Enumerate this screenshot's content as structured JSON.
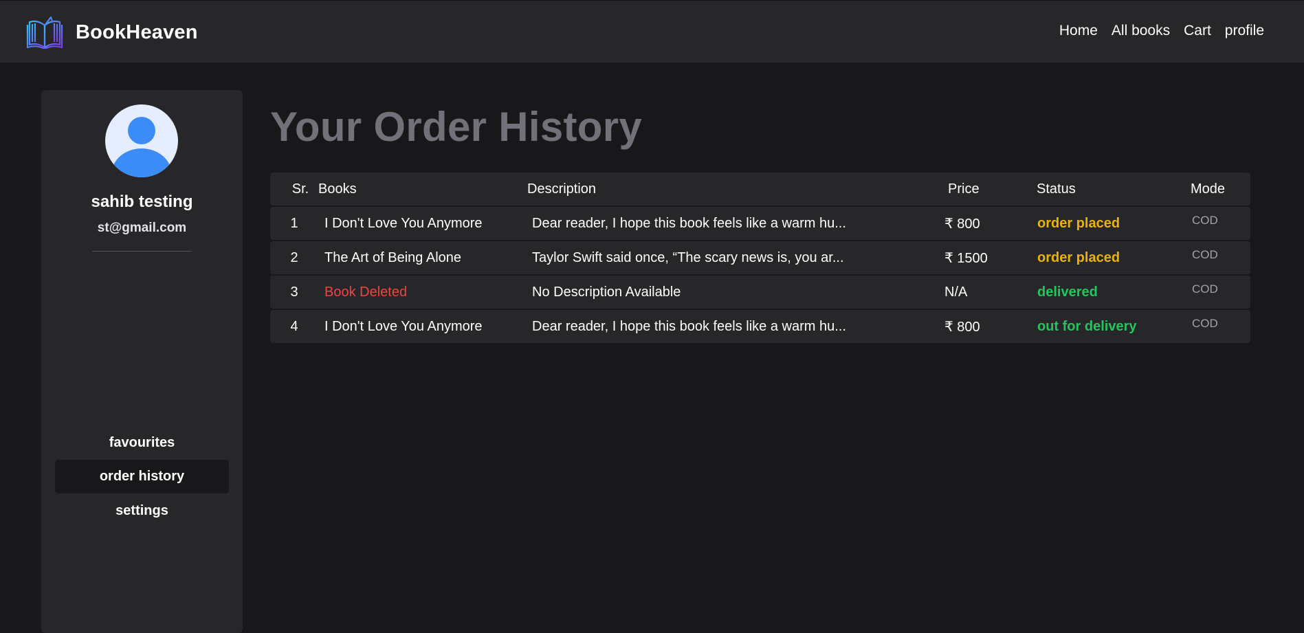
{
  "header": {
    "brand": "BookHeaven",
    "logo_icon": "open-book-icon",
    "nav": [
      "Home",
      "All books",
      "Cart",
      "profile"
    ]
  },
  "sidebar": {
    "avatar_icon": "user-avatar-icon",
    "name": "sahib testing",
    "email": "st@gmail.com",
    "menu": [
      "favourites",
      "order history",
      "settings"
    ],
    "active": "order history"
  },
  "main": {
    "title": "Your Order History",
    "columns": [
      "Sr.",
      "Books",
      "Description",
      "Price",
      "Status",
      "Mode"
    ],
    "orders": [
      {
        "sr": "1",
        "book": "I Don't Love You Anymore",
        "description": "Dear reader, I hope this book feels like a warm hu...",
        "price": "₹ 800",
        "status": "order placed",
        "mode": "COD"
      },
      {
        "sr": "2",
        "book": "The Art of Being Alone",
        "description": "Taylor Swift said once, “The scary news is, you ar...",
        "price": "₹ 1500",
        "status": "order placed",
        "mode": "COD"
      },
      {
        "sr": "3",
        "book": "Book Deleted",
        "description": "No Description Available",
        "price": "N/A",
        "status": "delivered",
        "mode": "COD"
      },
      {
        "sr": "4",
        "book": "I Don't Love You Anymore",
        "description": "Dear reader, I hope this book feels like a warm hu...",
        "price": "₹ 800",
        "status": "out for delivery",
        "mode": "COD"
      }
    ]
  },
  "colors": {
    "background": "#18181b",
    "panel": "#27272a",
    "title": "#71717a",
    "status_placed": "#eab308",
    "status_delivered": "#22c55e",
    "deleted_book": "#ef4444",
    "logo_gradient": [
      "#6366f1",
      "#38bdf8"
    ],
    "avatar_blue": "#3b82f6"
  }
}
